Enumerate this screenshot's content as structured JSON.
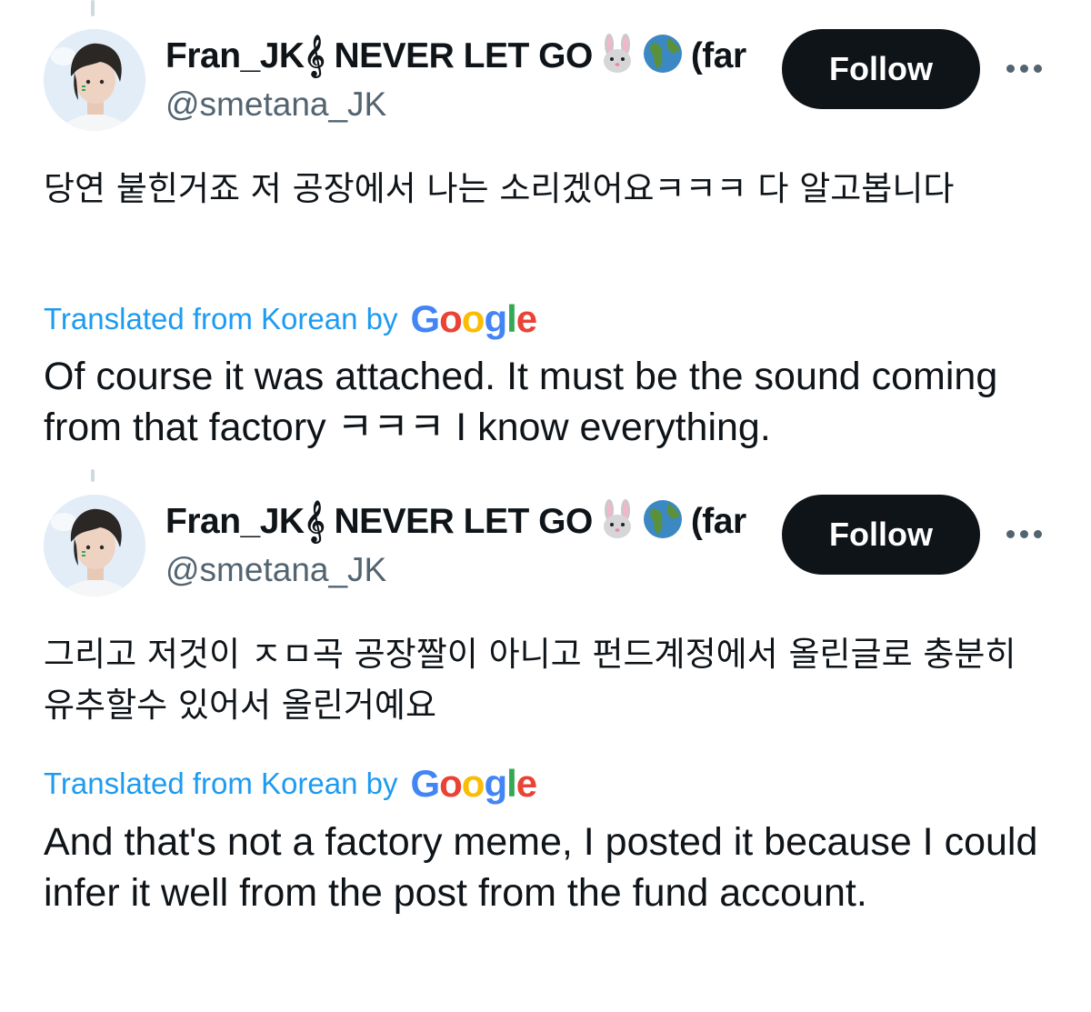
{
  "tweets": [
    {
      "author": {
        "display_name": "Fran_JK𝄞 NEVER LET GO",
        "display_name_suffix": "(far",
        "emojis": [
          "rabbit-face-icon",
          "globe-americas-icon"
        ],
        "handle": "@smetana_JK"
      },
      "follow_label": "Follow",
      "more_icon": "more-horizontal-icon",
      "original_text": "당연 붙힌거죠 저 공장에서 나는 소리겠어요ㅋㅋㅋ 다 알고봅니다",
      "translated_label": "Translated from Korean by",
      "translation": "Of course it was attached. It must be the sound coming from that factory ㅋㅋㅋ I know everything."
    },
    {
      "author": {
        "display_name": "Fran_JK𝄞 NEVER LET GO",
        "display_name_suffix": "(far",
        "emojis": [
          "rabbit-face-icon",
          "globe-americas-icon"
        ],
        "handle": "@smetana_JK"
      },
      "follow_label": "Follow",
      "more_icon": "more-horizontal-icon",
      "original_text": "그리고 저것이 ㅈㅁ곡 공장짤이 아니고 펀드계정에서 올린글로 충분히 유추할수 있어서 올린거예요",
      "translated_label": "Translated from Korean by",
      "translation": "And that's not a factory meme, I posted it because I could infer it well from the post from the fund account."
    }
  ],
  "google_logo": {
    "letters": [
      "G",
      "o",
      "o",
      "g",
      "l",
      "e"
    ],
    "colors": [
      "#4285f4",
      "#ea4335",
      "#fbbc05",
      "#4285f4",
      "#34a853",
      "#ea4335"
    ]
  },
  "colors": {
    "link_blue": "#1d9bf0",
    "text_primary": "#0f1419",
    "text_secondary": "#536471",
    "follow_bg": "#0f1419"
  }
}
